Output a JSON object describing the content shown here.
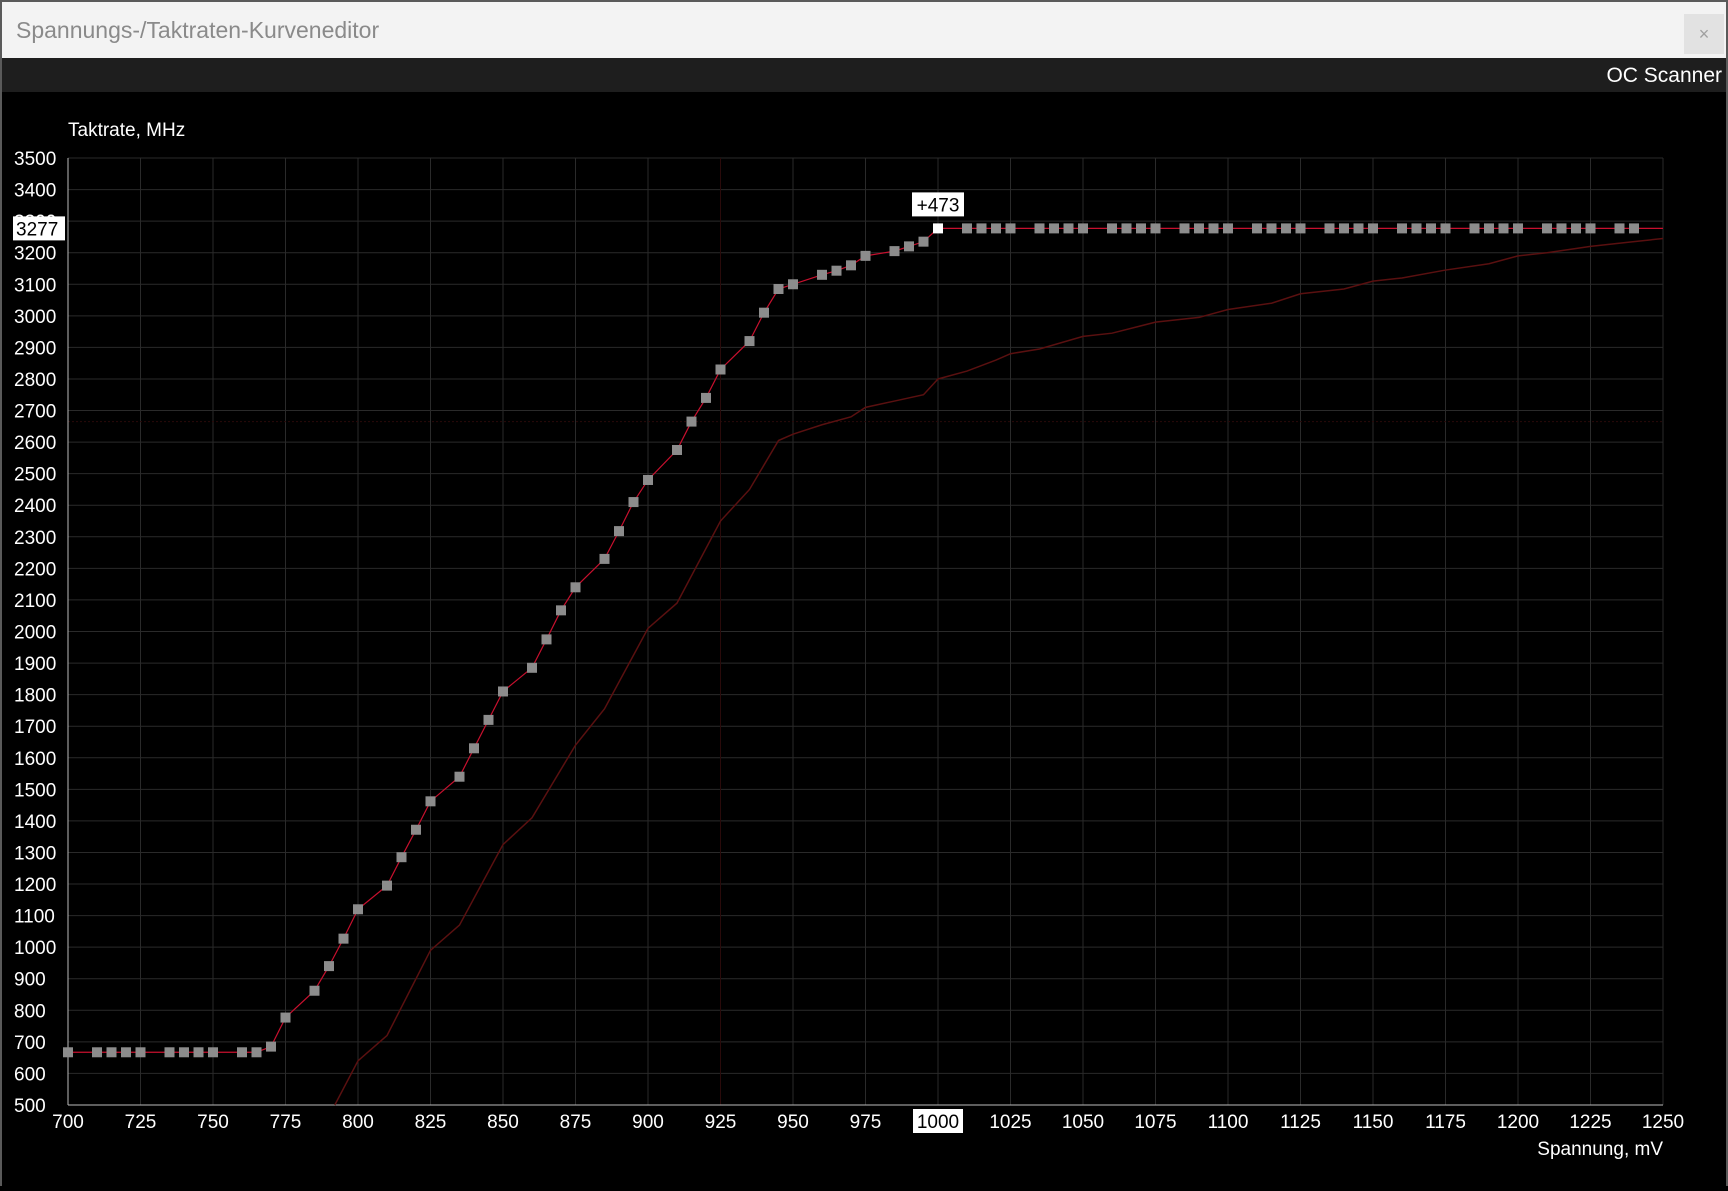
{
  "window": {
    "title": "Spannungs-/Taktraten-Kurveneditor",
    "close_label": "×"
  },
  "toolbar": {
    "oc_scanner_label": "OC Scanner"
  },
  "colors": {
    "background": "#000000",
    "grid": "#2a2a2a",
    "curve": "#c8102e",
    "point": "#8c8c8c",
    "selected_point": "#ffffff",
    "default_curve": "#5a1010"
  },
  "chart_data": {
    "type": "line",
    "ylabel": "Taktrate, MHz",
    "xlabel": "Spannung, mV",
    "xlim": [
      700,
      1250
    ],
    "ylim": [
      500,
      3500
    ],
    "x_ticks": [
      700,
      725,
      750,
      775,
      800,
      825,
      850,
      875,
      900,
      925,
      950,
      975,
      1000,
      1025,
      1050,
      1075,
      1100,
      1125,
      1150,
      1175,
      1200,
      1225,
      1250
    ],
    "y_ticks": [
      500,
      600,
      700,
      800,
      900,
      1000,
      1100,
      1200,
      1300,
      1400,
      1500,
      1600,
      1700,
      1800,
      1900,
      2000,
      2100,
      2200,
      2300,
      2400,
      2500,
      2600,
      2700,
      2800,
      2900,
      3000,
      3100,
      3200,
      3300,
      3400,
      3500
    ],
    "selected": {
      "x": 1000,
      "y": 3277,
      "x_label": "1000",
      "y_label": "3277",
      "offset_label": "+473"
    },
    "series": [
      {
        "name": "",
        "role": "edited-curve",
        "x": [
          700,
          710,
          715,
          720,
          725,
          735,
          740,
          745,
          750,
          760,
          765,
          770,
          775,
          785,
          790,
          795,
          800,
          810,
          815,
          820,
          825,
          835,
          840,
          845,
          850,
          860,
          865,
          870,
          875,
          885,
          890,
          895,
          900,
          910,
          915,
          920,
          925,
          935,
          940,
          945,
          950,
          960,
          965,
          970,
          975,
          985,
          990,
          995,
          1000,
          1010,
          1015,
          1020,
          1025,
          1035,
          1040,
          1045,
          1050,
          1060,
          1065,
          1070,
          1075,
          1085,
          1090,
          1095,
          1100,
          1110,
          1115,
          1120,
          1125,
          1135,
          1140,
          1145,
          1150,
          1160,
          1165,
          1170,
          1175,
          1185,
          1190,
          1195,
          1200,
          1210,
          1215,
          1220,
          1225,
          1235,
          1240
        ],
        "y": [
          667,
          667,
          667,
          667,
          667,
          667,
          667,
          667,
          667,
          667,
          667,
          685,
          777,
          862,
          940,
          1027,
          1120,
          1195,
          1285,
          1372,
          1462,
          1540,
          1630,
          1720,
          1810,
          1885,
          1975,
          2067,
          2140,
          2230,
          2318,
          2410,
          2480,
          2575,
          2665,
          2740,
          2830,
          2920,
          3010,
          3085,
          3100,
          3130,
          3143,
          3160,
          3190,
          3205,
          3220,
          3235,
          3277,
          3277,
          3277,
          3277,
          3277,
          3277,
          3277,
          3277,
          3277,
          3277,
          3277,
          3277,
          3277,
          3277,
          3277,
          3277,
          3277,
          3277,
          3277,
          3277,
          3277,
          3277,
          3277,
          3277,
          3277,
          3277,
          3277,
          3277,
          3277,
          3277,
          3277,
          3277,
          3277,
          3277,
          3277,
          3277,
          3277,
          3277,
          3277
        ]
      },
      {
        "name": "",
        "role": "default-curve",
        "x": [
          792,
          800,
          810,
          825,
          835,
          850,
          860,
          875,
          885,
          900,
          910,
          925,
          935,
          945,
          950,
          960,
          970,
          975,
          985,
          995,
          1000,
          1010,
          1020,
          1025,
          1035,
          1050,
          1060,
          1075,
          1090,
          1100,
          1115,
          1125,
          1140,
          1150,
          1160,
          1175,
          1190,
          1200,
          1210,
          1225,
          1240,
          1250
        ],
        "y": [
          500,
          640,
          720,
          990,
          1070,
          1325,
          1410,
          1640,
          1755,
          2010,
          2090,
          2350,
          2450,
          2605,
          2625,
          2655,
          2680,
          2710,
          2730,
          2750,
          2800,
          2825,
          2860,
          2880,
          2895,
          2935,
          2945,
          2980,
          2995,
          3020,
          3040,
          3070,
          3085,
          3110,
          3120,
          3145,
          3165,
          3190,
          3200,
          3220,
          3235,
          3245
        ]
      }
    ]
  }
}
